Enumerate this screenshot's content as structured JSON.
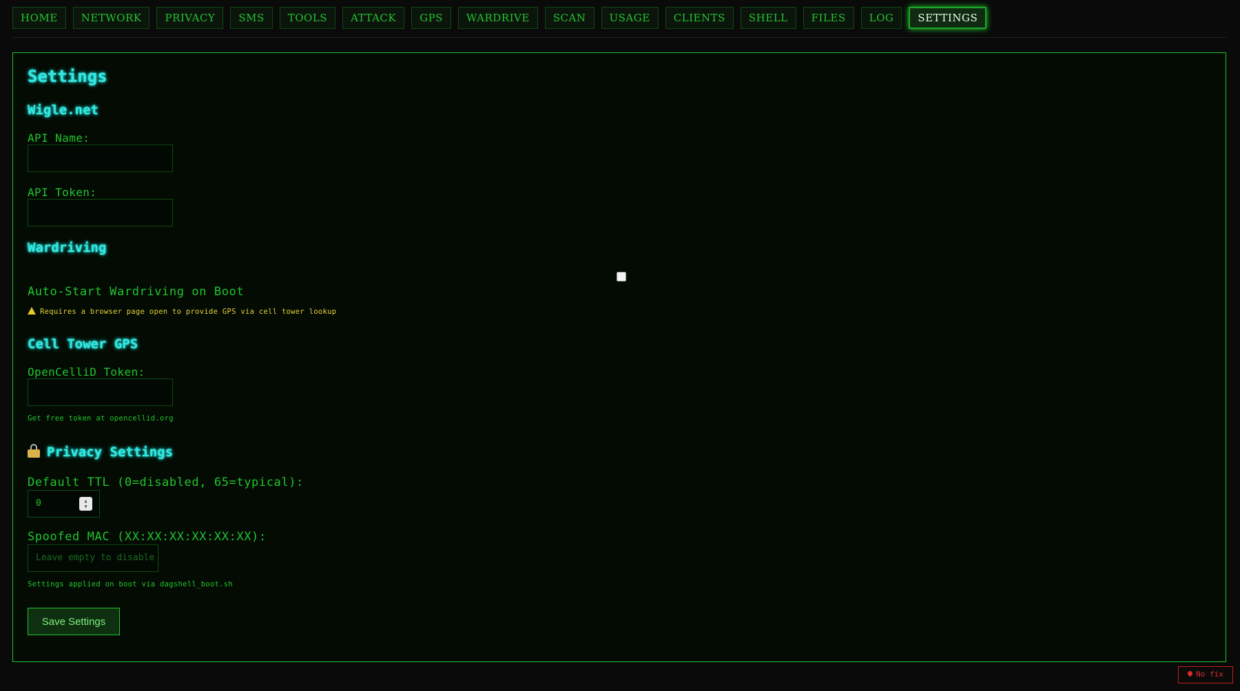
{
  "nav": {
    "items": [
      {
        "label": "HOME"
      },
      {
        "label": "NETWORK"
      },
      {
        "label": "PRIVACY"
      },
      {
        "label": "SMS"
      },
      {
        "label": "TOOLS"
      },
      {
        "label": "ATTACK"
      },
      {
        "label": "GPS"
      },
      {
        "label": "WARDRIVE"
      },
      {
        "label": "SCAN"
      },
      {
        "label": "USAGE"
      },
      {
        "label": "CLIENTS"
      },
      {
        "label": "SHELL"
      },
      {
        "label": "FILES"
      },
      {
        "label": "LOG"
      },
      {
        "label": "SETTINGS",
        "active": true
      }
    ]
  },
  "settings": {
    "title": "Settings",
    "wigle": {
      "heading": "Wigle.net",
      "api_name_label": "API Name:",
      "api_name_value": "",
      "api_token_label": "API Token:",
      "api_token_value": ""
    },
    "wardriving": {
      "heading": "Wardriving",
      "autostart_label": "Auto-Start Wardriving on Boot",
      "autostart_checked": false,
      "warning": "Requires a browser page open to provide GPS via cell tower lookup"
    },
    "cell_tower": {
      "heading": "Cell Tower GPS",
      "token_label": "OpenCelliD Token:",
      "token_value": "",
      "hint": "Get free token at opencellid.org"
    },
    "privacy": {
      "heading": "Privacy Settings",
      "ttl_label": "Default TTL (0=disabled, 65=typical):",
      "ttl_value": "0",
      "mac_label": "Spoofed MAC (XX:XX:XX:XX:XX:XX):",
      "mac_placeholder": "Leave empty to disable",
      "note": "Settings applied on boot via dagshell_boot.sh"
    },
    "save_label": "Save Settings"
  },
  "status": {
    "gps_text": "No fix"
  },
  "colors": {
    "accent": "#22c52e",
    "heading": "#36e6e0",
    "warning": "#e6d03a",
    "error": "#e02a2a"
  }
}
